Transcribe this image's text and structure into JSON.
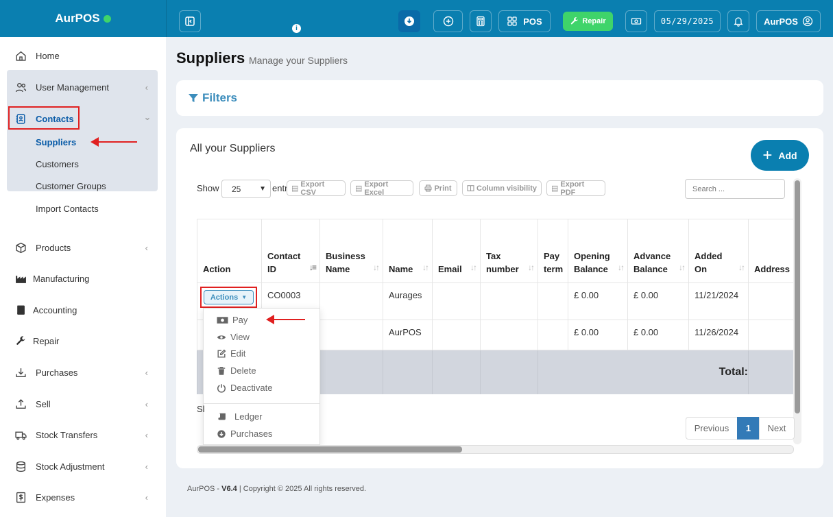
{
  "brand": {
    "name": "AurPOS"
  },
  "topbar": {
    "pos_label": "POS",
    "repair_label": "Repair",
    "date": "05/29/2025",
    "user_label": "AurPOS",
    "info_glyph": "i"
  },
  "sidebar": {
    "items": [
      {
        "label": "Home",
        "icon": "home-icon"
      },
      {
        "label": "User Management",
        "icon": "users-icon"
      },
      {
        "label": "Contacts",
        "icon": "contacts-icon"
      },
      {
        "label": "Products",
        "icon": "box-icon"
      },
      {
        "label": "Manufacturing",
        "icon": "factory-icon"
      },
      {
        "label": "Accounting",
        "icon": "book-icon"
      },
      {
        "label": "Repair",
        "icon": "wrench-icon"
      },
      {
        "label": "Purchases",
        "icon": "download-icon"
      },
      {
        "label": "Sell",
        "icon": "upload-icon"
      },
      {
        "label": "Stock Transfers",
        "icon": "truck-icon"
      },
      {
        "label": "Stock Adjustment",
        "icon": "database-icon"
      },
      {
        "label": "Expenses",
        "icon": "dollar-icon"
      }
    ],
    "contacts_sub": [
      "Suppliers",
      "Customers",
      "Customer Groups",
      "Import Contacts"
    ]
  },
  "page": {
    "title": "Suppliers",
    "subtitle": "Manage your Suppliers",
    "filters_label": "Filters",
    "card_title": "All your Suppliers",
    "add_label": "Add"
  },
  "controls": {
    "show_label": "Show",
    "entries_label": "entries",
    "page_length": "25",
    "export_csv": "Export CSV",
    "export_excel": "Export Excel",
    "print": "Print",
    "column_visibility": "Column visibility",
    "export_pdf": "Export PDF",
    "search_placeholder": "Search ..."
  },
  "table": {
    "headers": [
      "Action",
      "Contact ID",
      "Business Name",
      "Name",
      "Email",
      "Tax number",
      "Pay term",
      "Opening Balance",
      "Advance Balance",
      "Added On",
      "Address"
    ],
    "rows": [
      {
        "contact_id": "CO0003",
        "business_name": "",
        "name": "Aurages",
        "email": "",
        "tax_number": "",
        "pay_term": "",
        "opening_balance": "£ 0.00",
        "advance_balance": "£ 0.00",
        "added_on": "11/21/2024",
        "address": ""
      },
      {
        "contact_id": "",
        "business_name": "",
        "name": "AurPOS",
        "email": "",
        "tax_number": "",
        "pay_term": "",
        "opening_balance": "£ 0.00",
        "advance_balance": "£ 0.00",
        "added_on": "11/26/2024",
        "address": ""
      }
    ],
    "total_label": "Total:",
    "actions_label": "Actions"
  },
  "dropdown": {
    "items": [
      "Pay",
      "View",
      "Edit",
      "Delete",
      "Deactivate",
      "Ledger",
      "Purchases"
    ]
  },
  "pagination": {
    "showing_prefix": "Sl",
    "previous": "Previous",
    "current": "1",
    "next": "Next"
  },
  "footer": {
    "app": "AurPOS",
    "separator": " - ",
    "version": "V6.4",
    "copyright": " | Copyright © 2025 All rights reserved."
  },
  "colors": {
    "primary": "#0a7fb0",
    "repair_green": "#3fd46a",
    "annotation_red": "#e02020",
    "link_blue": "#3c8dbc"
  }
}
